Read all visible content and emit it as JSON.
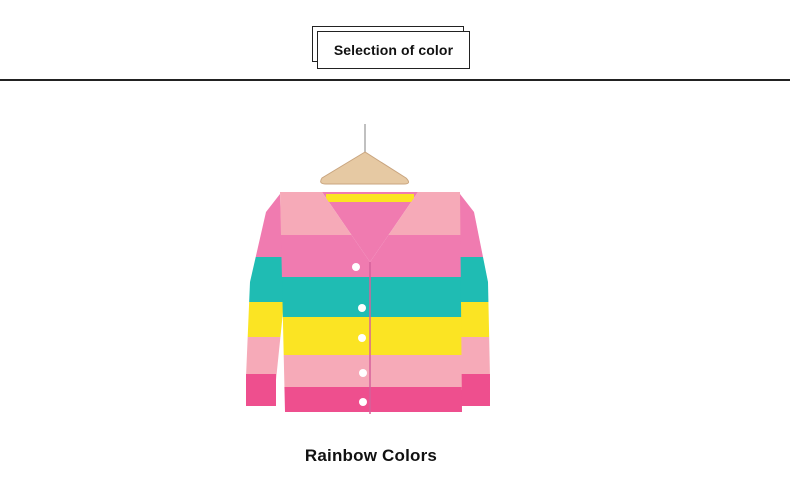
{
  "header": {
    "title": "Selection of color"
  },
  "product": {
    "image": "rainbow-striped-cardigan-photo",
    "name": "Rainbow Colors",
    "colors": {
      "pink": "#f07bb0",
      "light_pink": "#f6aab8",
      "teal": "#1fbcb3",
      "yellow": "#fbe423",
      "rib_pink": "#ee4f8e"
    }
  }
}
